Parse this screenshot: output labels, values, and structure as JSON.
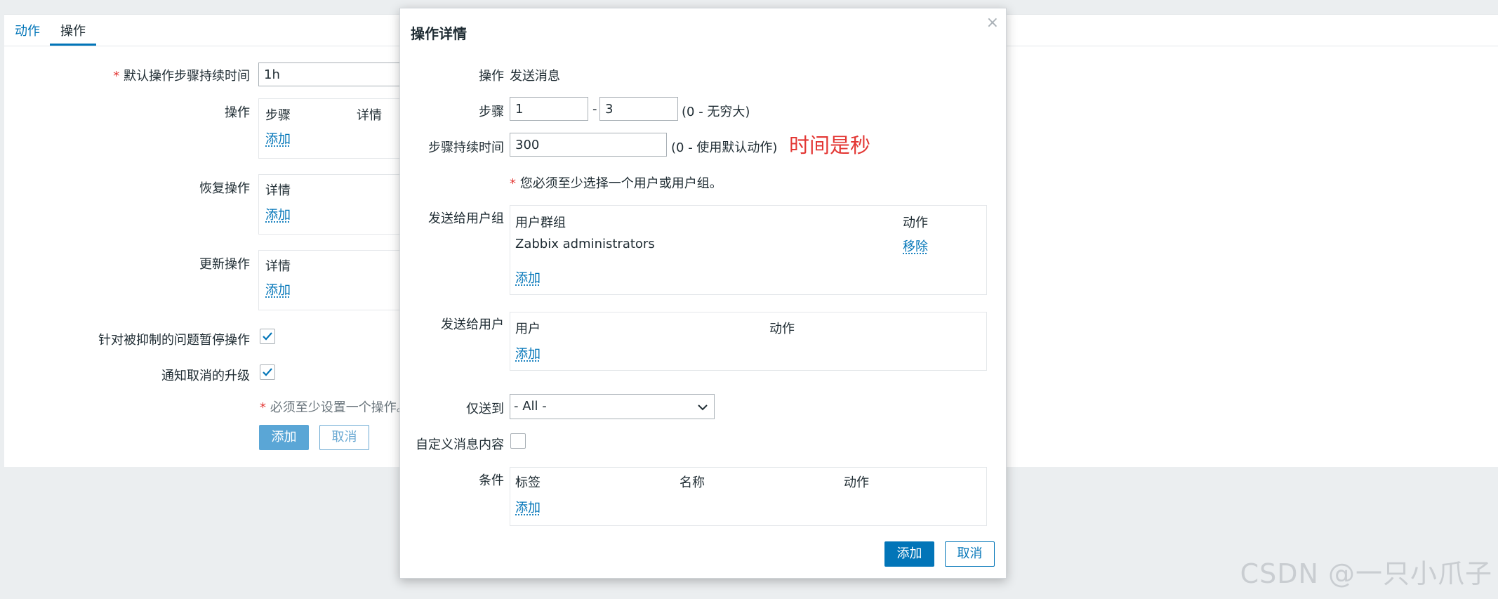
{
  "tabs": [
    {
      "label": "动作"
    },
    {
      "label": "操作"
    }
  ],
  "form": {
    "default_duration_label": "默认操作步骤持续时间",
    "default_duration_value": "1h",
    "operations_label": "操作",
    "operations_cols": [
      "步骤",
      "详情"
    ],
    "recovery_label": "恢复操作",
    "recovery_col": "详情",
    "update_label": "更新操作",
    "update_col": "详情",
    "add_link": "添加",
    "pause_label": "针对被抑制的问题暂停操作",
    "notify_cancel_label": "通知取消的升级",
    "must_one_op": "必须至少设置一个操作。",
    "add_button": "添加",
    "cancel_button": "取消"
  },
  "dialog": {
    "title": "操作详情",
    "close_icon": "×",
    "operation_label": "操作",
    "operation_value": "发送消息",
    "steps_label": "步骤",
    "step_from": "1",
    "step_sep": "-",
    "step_to": "3",
    "steps_hint": "(0 - 无穷大)",
    "duration_label": "步骤持续时间",
    "duration_value": "300",
    "duration_hint": "(0 - 使用默认动作)",
    "annotation": "时间是秒",
    "must_select": "您必须至少选择一个用户或用户组。",
    "user_groups_label": "发送给用户组",
    "user_groups_cols": [
      "用户群组",
      "动作"
    ],
    "user_groups_rows": [
      {
        "name": "Zabbix administrators",
        "action": "移除"
      }
    ],
    "users_label": "发送给用户",
    "users_cols": [
      "用户",
      "动作"
    ],
    "send_only_label": "仅送到",
    "send_only_value": "- All -",
    "custom_msg_label": "自定义消息内容",
    "conditions_label": "条件",
    "conditions_cols": [
      "标签",
      "名称",
      "动作"
    ],
    "add_link": "添加",
    "add_button": "添加",
    "cancel_button": "取消"
  },
  "watermark": "CSDN @一只小爪子",
  "colors": {
    "accent": "#0275b8",
    "required": "#e33734",
    "annotation": "#e33734"
  }
}
